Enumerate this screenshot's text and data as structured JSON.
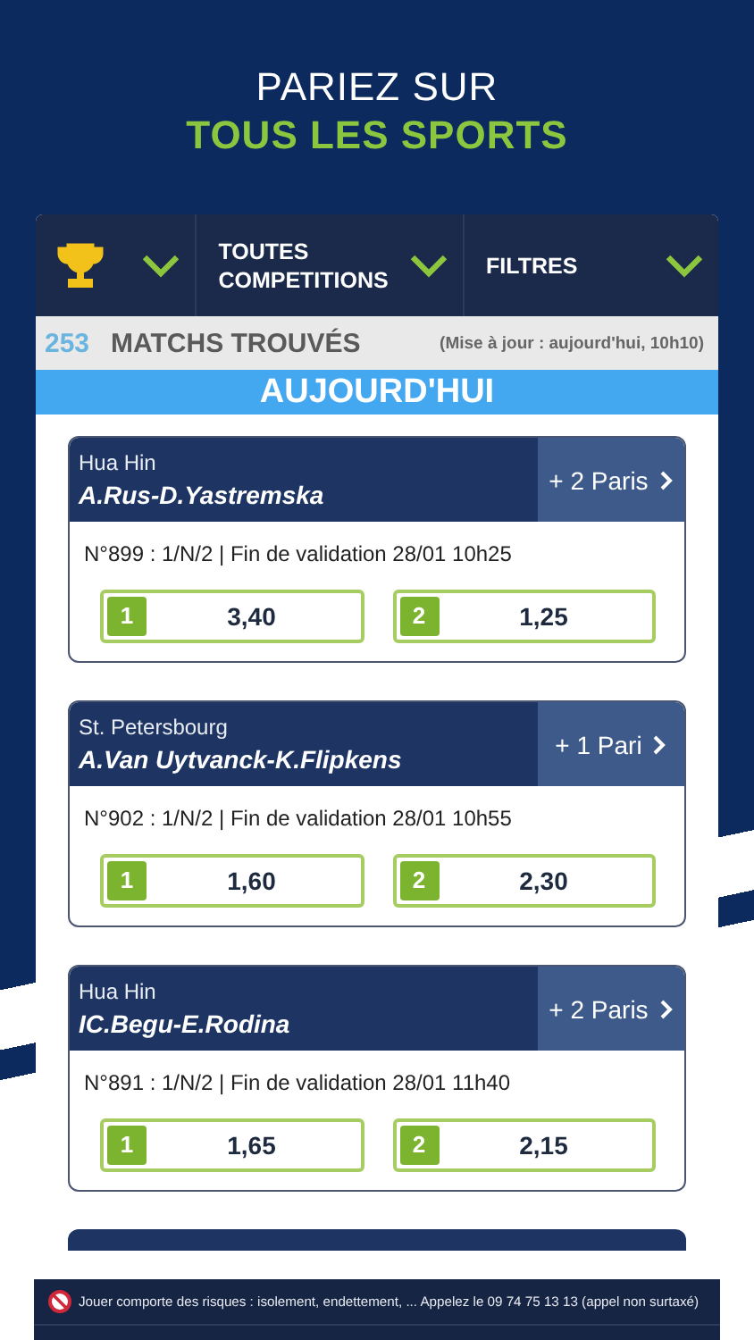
{
  "header": {
    "line_1": "PARIEZ SUR",
    "line_2": "TOUS LES SPORTS"
  },
  "filters": [
    {
      "kind": "sport"
    },
    {
      "kind": "text",
      "label": "TOUTES COMPETITIONS"
    },
    {
      "kind": "text",
      "label": "FILTRES"
    }
  ],
  "summary": {
    "count": "253",
    "label": "MATCHS TROUVÉS",
    "updated": "(Mise à jour : aujourd'hui, 10h10)"
  },
  "day_banner": "AUJOURD'HUI",
  "matches": [
    {
      "location": "Hua Hin",
      "teams": "A.Rus-D.Yastremska",
      "more_bets": "+ 2 Paris",
      "info": "N°899 : 1/N/2 | Fin de validation 28/01 10h25",
      "odds": [
        {
          "label": "1",
          "value": "3,40"
        },
        {
          "label": "2",
          "value": "1,25"
        }
      ]
    },
    {
      "location": "St. Petersbourg",
      "teams": "A.Van Uytvanck-K.Flipkens",
      "more_bets": "+ 1 Pari",
      "info": "N°902 : 1/N/2 | Fin de validation 28/01 10h55",
      "odds": [
        {
          "label": "1",
          "value": "1,60"
        },
        {
          "label": "2",
          "value": "2,30"
        }
      ]
    },
    {
      "location": "Hua Hin",
      "teams": "IC.Begu-E.Rodina",
      "more_bets": "+ 2 Paris",
      "info": "N°891 : 1/N/2 | Fin de validation 28/01 11h40",
      "odds": [
        {
          "label": "1",
          "value": "1,65"
        },
        {
          "label": "2",
          "value": "2,15"
        }
      ]
    }
  ],
  "disclaimer": "Jouer comporte des risques : isolement, endettement, ... Appelez le 09 74 75 13 13 (appel non surtaxé)"
}
